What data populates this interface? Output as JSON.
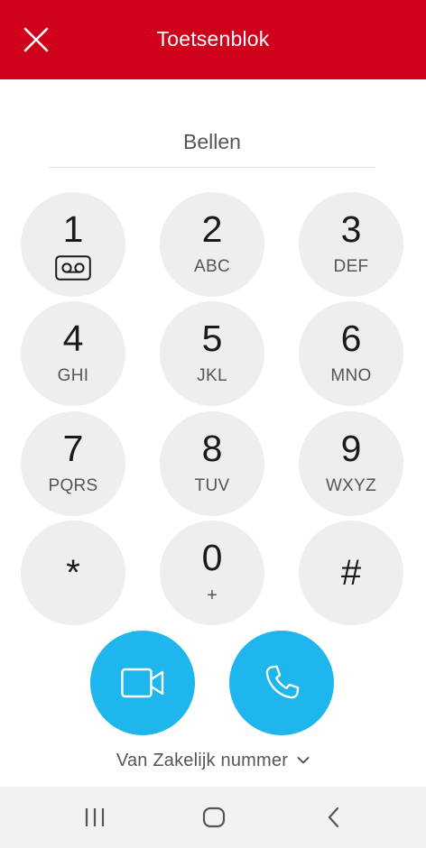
{
  "header": {
    "title": "Toetsenblok",
    "close_icon": "close-icon",
    "background_color": "#d0021b"
  },
  "dial_input": {
    "value": "",
    "placeholder": "Bellen"
  },
  "keypad": {
    "keys": [
      {
        "digit": "1",
        "letters": "",
        "icon": "voicemail-icon"
      },
      {
        "digit": "2",
        "letters": "ABC"
      },
      {
        "digit": "3",
        "letters": "DEF"
      },
      {
        "digit": "4",
        "letters": "GHI"
      },
      {
        "digit": "5",
        "letters": "JKL"
      },
      {
        "digit": "6",
        "letters": "MNO"
      },
      {
        "digit": "7",
        "letters": "PQRS"
      },
      {
        "digit": "8",
        "letters": "TUV"
      },
      {
        "digit": "9",
        "letters": "WXYZ"
      },
      {
        "digit": "*",
        "letters": ""
      },
      {
        "digit": "0",
        "letters": "+"
      },
      {
        "digit": "#",
        "letters": ""
      }
    ],
    "key_color": "#eeeeee"
  },
  "actions": {
    "video_call_icon": "video-camera-icon",
    "voice_call_icon": "phone-handset-icon",
    "accent_color": "#1fb6ee"
  },
  "caller_id": {
    "label": "Van Zakelijk nummer",
    "icon": "chevron-down-icon"
  },
  "system_nav": {
    "recents_icon": "recent-apps-icon",
    "home_icon": "home-icon",
    "back_icon": "back-icon"
  }
}
